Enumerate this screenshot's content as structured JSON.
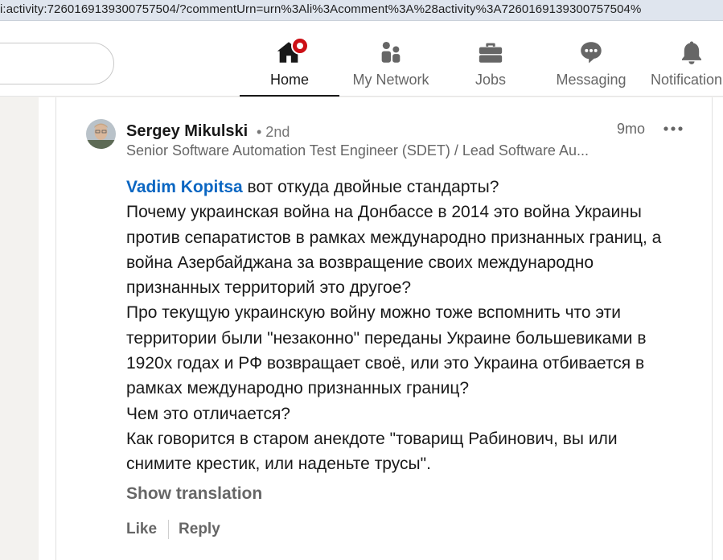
{
  "browser": {
    "url": "i:activity:7260169139300757504/?commentUrn=urn%3Ali%3Acomment%3A%28activity%3A7260169139300757504%"
  },
  "nav": {
    "items": [
      {
        "label": "Home",
        "icon": "home-icon"
      },
      {
        "label": "My Network",
        "icon": "people-icon"
      },
      {
        "label": "Jobs",
        "icon": "briefcase-icon"
      },
      {
        "label": "Messaging",
        "icon": "chat-icon"
      },
      {
        "label": "Notification",
        "icon": "bell-icon"
      }
    ],
    "active": "Home"
  },
  "comment": {
    "author": "Sergey Mikulski",
    "degree": "• 2nd",
    "headline": "Senior Software Automation Test Engineer (SDET) / Lead Software Au...",
    "timestamp": "9mo",
    "mention": "Vadim Kopitsa",
    "lines": [
      " вот откуда двойные стандарты?",
      "Почему украинская война на Донбассе в 2014 это война Украины",
      "против сепаратистов в рамках международно признанных границ, а",
      "война Азербайджана за возвращение своих международно",
      "признанных территорий это другое?",
      "Про текущую украинскую войну можно тоже вспомнить что эти",
      "территории были \"незаконно\" переданы Украине большевиками в",
      "1920х годах и РФ возвращает своё, или это Украина отбивается в",
      "рамках международно признанных границ?",
      "Чем это отличается?",
      "Как говорится в старом анекдоте \"товарищ Рабинович, вы или",
      "снимите крестик, или наденьте трусы\"."
    ],
    "show_translation": "Show translation",
    "like_label": "Like",
    "reply_label": "Reply"
  },
  "colors": {
    "link": "#0a66c2",
    "badge": "#cc1016",
    "icon": "#666666"
  }
}
